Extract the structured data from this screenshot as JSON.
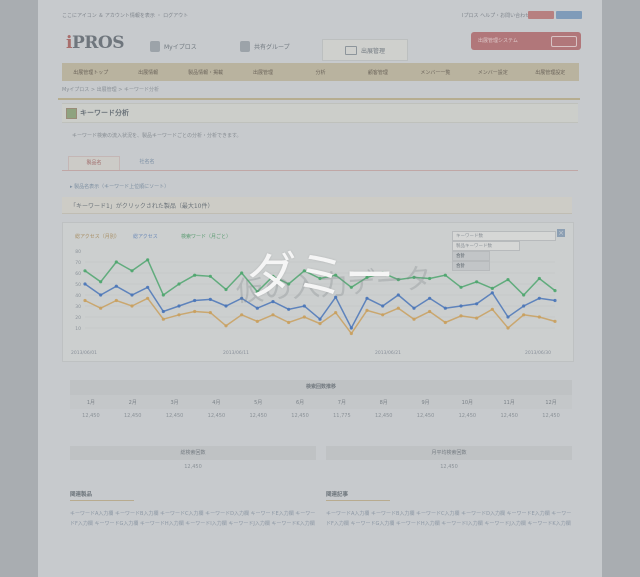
{
  "header": {
    "top_note": "ここにアイコン ＆ アカウント情報を表示 ・ ログアウト",
    "top_link": "Iプロス ヘルプ・お問い合わせ",
    "logo": "iPROS",
    "nav_pills": [
      "Myイプロス",
      "共有グループ",
      "出展管理"
    ],
    "service_button": "出展管理システム"
  },
  "nav": {
    "items": [
      "出展管理トップ",
      "出展情報",
      "製品情報・掲載",
      "出展管理",
      "分析",
      "顧客管理",
      "メンバー一覧",
      "メンバー設定",
      "出展管理設定"
    ]
  },
  "breadcrumb": "Myイプロス > 出展管理 > キーワード分析",
  "page": {
    "title": "キーワード分析",
    "description": "キーワード検索の流入状況を、製品キーワードごとの分析・分析できます。"
  },
  "tabs": [
    "製品名",
    "社名名"
  ],
  "note": "▸ 製品名表示（キーワード上位順にソート）",
  "section_title": "「キーワード1」がクリックされた製品（最大10件）",
  "chart_data": {
    "type": "line",
    "series": [
      {
        "name": "検索ワード（月ごと）",
        "color": "#4ea66e",
        "values": [
          62,
          52,
          70,
          62,
          72,
          40,
          50,
          58,
          57,
          45,
          60,
          43,
          57,
          50,
          62,
          55,
          58,
          47,
          56,
          60,
          54,
          56,
          55,
          58,
          47,
          52,
          46,
          54,
          40,
          55,
          44
        ]
      },
      {
        "name": "総アクセス",
        "color": "#4a76b8",
        "values": [
          50,
          40,
          48,
          40,
          47,
          25,
          30,
          35,
          36,
          30,
          37,
          28,
          34,
          27,
          30,
          18,
          38,
          10,
          37,
          30,
          40,
          28,
          37,
          28,
          30,
          32,
          42,
          20,
          30,
          37,
          35
        ]
      },
      {
        "name": "総アクセス（月別）",
        "color": "#c9a05e",
        "values": [
          35,
          28,
          35,
          30,
          37,
          18,
          22,
          25,
          24,
          12,
          22,
          16,
          22,
          15,
          20,
          14,
          24,
          5,
          26,
          22,
          28,
          18,
          25,
          15,
          21,
          19,
          27,
          10,
          22,
          20,
          16
        ]
      }
    ],
    "x_tick_labels": [
      "2013/06/01",
      "2013/06/11",
      "2013/06/21",
      "2013/06/30"
    ],
    "y_tick_labels": [
      "80",
      "70",
      "60",
      "50",
      "40",
      "30",
      "20",
      "10"
    ],
    "tooltip": [
      "キーワード数",
      "製品キーワード数",
      "合計",
      "合計"
    ],
    "ylim": [
      0,
      80
    ]
  },
  "monthly": {
    "title": "検索回数推移",
    "months": [
      "1月",
      "2月",
      "3月",
      "4月",
      "5月",
      "6月",
      "7月",
      "8月",
      "9月",
      "10月",
      "11月",
      "12月"
    ],
    "values": [
      "12,450",
      "12,450",
      "12,450",
      "12,450",
      "12,450",
      "12,450",
      "11,775",
      "12,450",
      "12,450",
      "12,450",
      "12,450",
      "12,450"
    ]
  },
  "totals": [
    {
      "label": "総検索回数",
      "value": "12,450"
    },
    {
      "label": "月平均検索回数",
      "value": "12,450"
    }
  ],
  "keywords": [
    {
      "title": "関連製品",
      "text": "キーワードA入力欄 キーワードB入力欄 キーワードC入力欄 キーワードD入力欄 キーワードE入力欄 キーワードF入力欄 キーワードG入力欄 キーワードH入力欄 キーワードI入力欄 キーワードJ入力欄 キーワードK入力欄"
    },
    {
      "title": "関連記事",
      "text": "キーワードA入力欄 キーワードB入力欄 キーワードC入力欄 キーワードD入力欄 キーワードE入力欄 キーワードF入力欄 キーワードG入力欄 キーワードH入力欄 キーワードI入力欄 キーワードJ入力欄 キーワードK入力欄"
    }
  ],
  "overlay": {
    "watermark": "ダミー",
    "stamp": "仮の入力データ"
  },
  "colors": {
    "accent": "#b1777a",
    "green_series": "#4ea66e",
    "blue_series": "#4a76b8",
    "orange_series": "#c9a05e"
  }
}
